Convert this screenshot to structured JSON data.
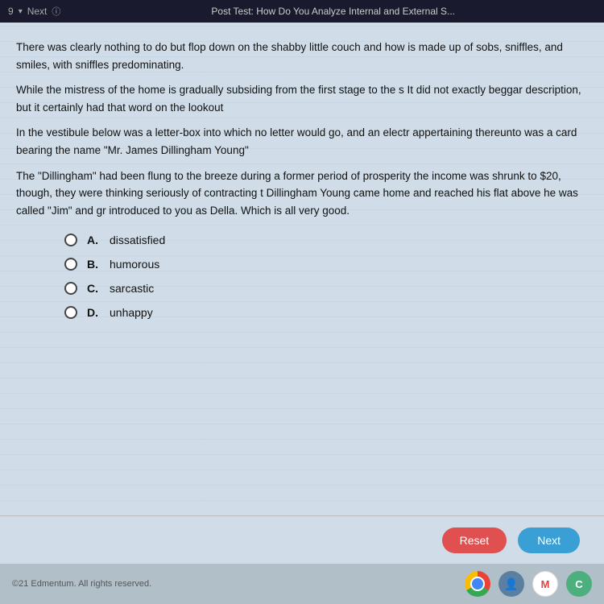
{
  "topbar": {
    "question_num": "9",
    "next_label": "Next",
    "title": "Post Test: How Do You Analyze Internal and External S..."
  },
  "passage": {
    "paragraph1": "There was clearly nothing to do but flop down on the shabby little couch and how is made up of sobs, sniffles, and smiles, with sniffles predominating.",
    "paragraph2": "While the mistress of the home is gradually subsiding from the first stage to the s It did not exactly beggar description, but it certainly had that word on the lookout",
    "paragraph3": "In the vestibule below was a letter-box into which no letter would go, and an electr appertaining thereunto was a card bearing the name \"Mr. James Dillingham Young\"",
    "paragraph4": "The \"Dillingham\" had been flung to the breeze during a former period of prosperity the income was shrunk to $20, though, they were thinking seriously of contracting t Dillingham Young came home and reached his flat above he was called \"Jim\" and gr introduced to you as Della. Which is all very good."
  },
  "options": [
    {
      "letter": "A.",
      "text": "dissatisfied"
    },
    {
      "letter": "B.",
      "text": "humorous"
    },
    {
      "letter": "C.",
      "text": "sarcastic"
    },
    {
      "letter": "D.",
      "text": "unhappy"
    }
  ],
  "buttons": {
    "reset_label": "Reset",
    "next_label": "Next"
  },
  "footer": {
    "copyright": "©21 Edmentum. All rights reserved."
  }
}
